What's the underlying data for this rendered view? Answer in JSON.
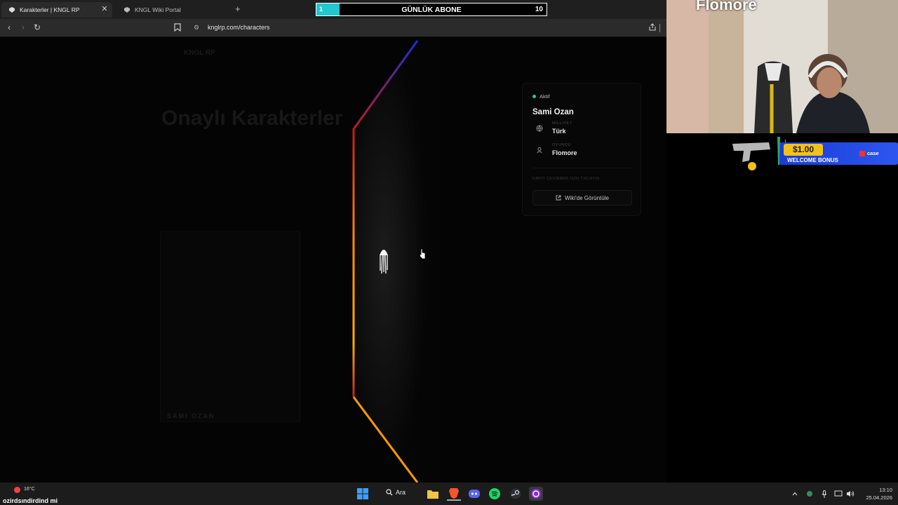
{
  "browser": {
    "tabs": [
      {
        "title": "Karakterler | KNGL RP",
        "active": true
      },
      {
        "title": "KNGL Wiki Portal",
        "active": false
      }
    ],
    "url": "knglrp.com/characters"
  },
  "subscriber_goal": {
    "title": "GÜNLÜK ABONE",
    "current": "1",
    "goal": "10",
    "progress": 0.1
  },
  "page_background": {
    "logo": "KNGL RP",
    "heading": "Onaylı Karakterler",
    "card_name": "SAMI OZAN"
  },
  "character_panel": {
    "status": "Aktif",
    "name": "Sami Ozan",
    "fields": [
      {
        "label": "MILLIYET",
        "value": "Türk",
        "icon": "globe-icon"
      },
      {
        "label": "OYUNCU",
        "value": "Flomore",
        "icon": "user-icon"
      }
    ],
    "hint": "KARTI ÇEVİRMEK İÇİN TIKLAYIN",
    "wiki_button": "Wiki'de Görüntüle"
  },
  "webcam": {
    "name": "Flomore"
  },
  "ad": {
    "price": "$1.00",
    "text": "WELCOME BONUS",
    "brand": "case"
  },
  "taskbar": {
    "weather_temp": "16°C",
    "weather_desc": "ozirdsındirdind mi",
    "search_label": "Ara",
    "time": "13:10",
    "date": "25.04.2026"
  },
  "colors": {
    "status_active": "#2ecc71",
    "sub_fill": "#22c7cf",
    "ad_blue": "#2d56f0",
    "ad_gold": "#f2c21b"
  }
}
